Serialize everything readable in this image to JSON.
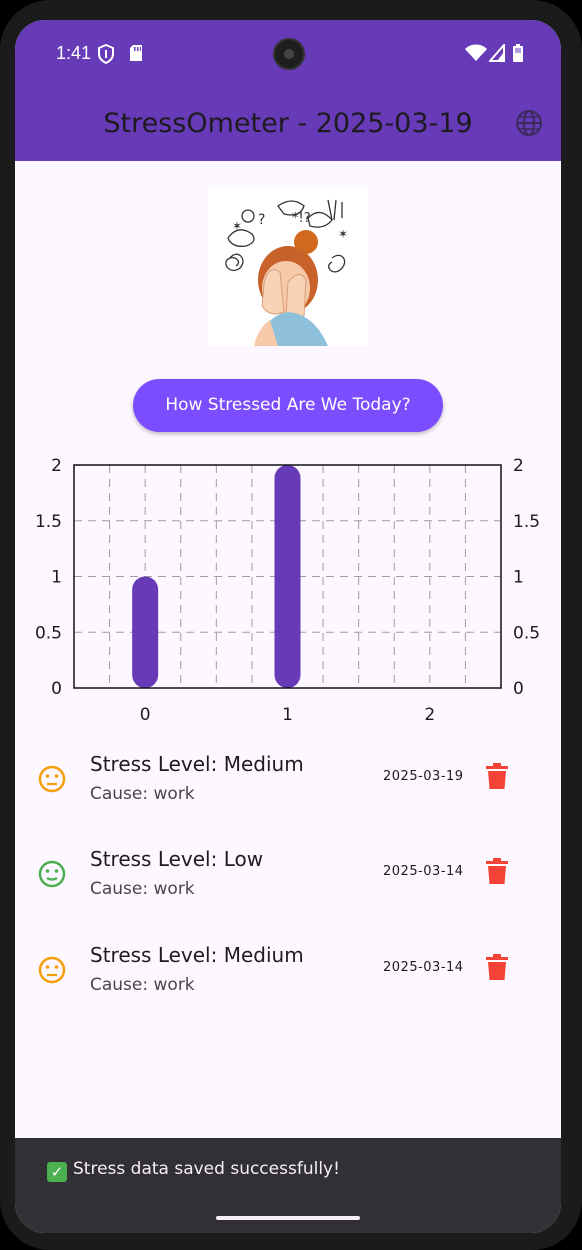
{
  "status_bar": {
    "time": "1:41",
    "icons": [
      "shield-icon",
      "sd-card-icon",
      "wifi-icon",
      "signal-icon",
      "battery-icon"
    ]
  },
  "app_bar": {
    "title": "StressOmeter - 2025-03-19",
    "action_icon": "globe-icon",
    "color": "#673ab7"
  },
  "hero_image": {
    "icon": "stressed-woman-illustration"
  },
  "cta": {
    "label": "How Stressed Are We Today?",
    "color": "#7c4dff"
  },
  "chart_data": {
    "type": "bar",
    "categories": [
      "0",
      "1",
      "2"
    ],
    "values": [
      1,
      2,
      0
    ],
    "ylim": [
      0,
      2
    ],
    "y_ticks": [
      "0",
      "0.5",
      "1",
      "1.5",
      "2"
    ],
    "grid": true,
    "bar_color": "#673ab7"
  },
  "entries": [
    {
      "title": "Stress Level: Medium",
      "cause": "Cause: work",
      "date": "2025-03-19",
      "face_color": "#f59e0b",
      "icon": "neutral-face-icon"
    },
    {
      "title": "Stress Level: Low",
      "cause": "Cause: work",
      "date": "2025-03-14",
      "face_color": "#4caf50",
      "icon": "neutral-face-icon"
    },
    {
      "title": "Stress Level: Medium",
      "cause": "Cause: work",
      "date": "2025-03-14",
      "face_color": "#f59e0b",
      "icon": "neutral-face-icon"
    }
  ],
  "delete_icon_color": "#f44336",
  "snackbar": {
    "emoji": "✅",
    "message": "Stress data saved successfully!"
  }
}
